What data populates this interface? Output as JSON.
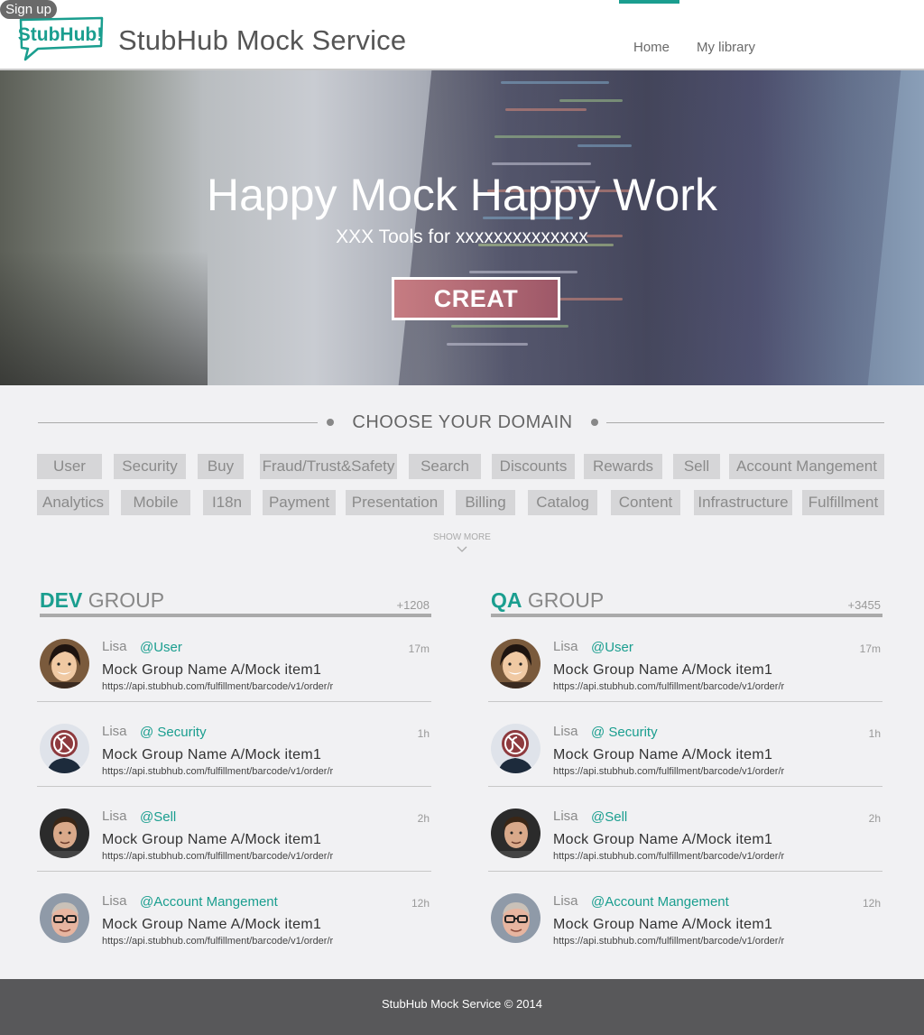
{
  "header": {
    "logo_text": "StubHub!",
    "title": "StubHub Mock Service",
    "nav": {
      "home": "Home",
      "library": "My library",
      "signup": "Sign up"
    },
    "accent_color": "#1a9e8f"
  },
  "hero": {
    "title": "Happy Mock Happy Work",
    "subtitle": "XXX Tools for xxxxxxxxxxxxxx",
    "button": "CREAT"
  },
  "domain": {
    "heading": "CHOOSE YOUR DOMAIN",
    "tags": [
      "User",
      "Security",
      "Buy",
      "Fraud/Trust&Safety",
      "Search",
      "Discounts",
      "Rewards",
      "Sell",
      "Account Mangement",
      "Analytics",
      "Mobile",
      "I18n",
      "Payment",
      "Presentation",
      "Billing",
      "Catalog",
      "Content",
      "Infrastructure",
      "Fulfillment"
    ],
    "show_more": "SHOW MORE"
  },
  "groups": [
    {
      "accent": "DEV",
      "rest": "GROUP",
      "count": "+1208",
      "items": [
        {
          "user": "Lisa",
          "tag": "@User",
          "time": "17m",
          "title": "Mock Group Name A/Mock item1",
          "url": "https://api.stubhub.com/fulfillment/barcode/v1/order/r",
          "avatar": "woman-avatar"
        },
        {
          "user": "Lisa",
          "tag": "@ Security",
          "time": "1h",
          "title": "Mock Group Name A/Mock item1",
          "url": "https://api.stubhub.com/fulfillment/barcode/v1/order/r",
          "avatar": "flash-blocked-avatar"
        },
        {
          "user": "Lisa",
          "tag": "@Sell",
          "time": "2h",
          "title": "Mock Group Name A/Mock item1",
          "url": "https://api.stubhub.com/fulfillment/barcode/v1/order/r",
          "avatar": "man-avatar"
        },
        {
          "user": "Lisa",
          "tag": "@Account Mangement",
          "time": "12h",
          "title": "Mock Group Name A/Mock item1",
          "url": "https://api.stubhub.com/fulfillment/barcode/v1/order/r",
          "avatar": "man-glasses-avatar"
        }
      ]
    },
    {
      "accent": "QA",
      "rest": "GROUP",
      "count": "+3455",
      "items": [
        {
          "user": "Lisa",
          "tag": "@User",
          "time": "17m",
          "title": "Mock Group Name A/Mock item1",
          "url": "https://api.stubhub.com/fulfillment/barcode/v1/order/r",
          "avatar": "woman-avatar"
        },
        {
          "user": "Lisa",
          "tag": "@ Security",
          "time": "1h",
          "title": "Mock Group Name A/Mock item1",
          "url": "https://api.stubhub.com/fulfillment/barcode/v1/order/r",
          "avatar": "flash-blocked-avatar"
        },
        {
          "user": "Lisa",
          "tag": "@Sell",
          "time": "2h",
          "title": "Mock Group Name A/Mock item1",
          "url": "https://api.stubhub.com/fulfillment/barcode/v1/order/r",
          "avatar": "man-avatar"
        },
        {
          "user": "Lisa",
          "tag": "@Account Mangement",
          "time": "12h",
          "title": "Mock Group Name A/Mock item1",
          "url": "https://api.stubhub.com/fulfillment/barcode/v1/order/r",
          "avatar": "man-glasses-avatar"
        }
      ]
    }
  ],
  "footer": {
    "text": "StubHub Mock Service © 2014"
  }
}
